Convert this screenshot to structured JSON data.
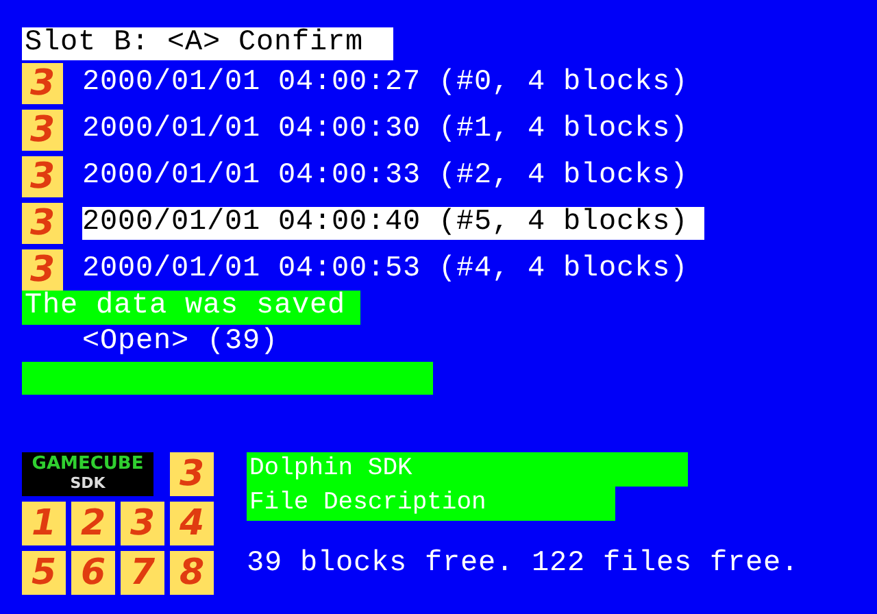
{
  "header": "Slot B:  <A> Confirm",
  "files": [
    {
      "icon": "3",
      "label": "2000/01/01 04:00:27 (#0, 4 blocks)",
      "selected": false
    },
    {
      "icon": "3",
      "label": "2000/01/01 04:00:30 (#1, 4 blocks)",
      "selected": false
    },
    {
      "icon": "3",
      "label": "2000/01/01 04:00:33 (#2, 4 blocks)",
      "selected": false
    },
    {
      "icon": "3",
      "label": "2000/01/01 04:00:40 (#5, 4 blocks)",
      "selected": true
    },
    {
      "icon": "3",
      "label": "2000/01/01 04:00:53 (#4, 4 blocks)",
      "selected": false
    }
  ],
  "message": "The data was saved",
  "open_entry": "<Open> (39)",
  "bar": {
    "level": 1
  },
  "banner": {
    "top": "GAMECUBE",
    "bottom": "SDK"
  },
  "file_icon": "3",
  "icon_frames": [
    "1",
    "2",
    "3",
    "4",
    "5",
    "6",
    "7",
    "8"
  ],
  "description": [
    "Dolphin SDK",
    "File Description"
  ],
  "free_space": "39 blocks free. 122 files free."
}
